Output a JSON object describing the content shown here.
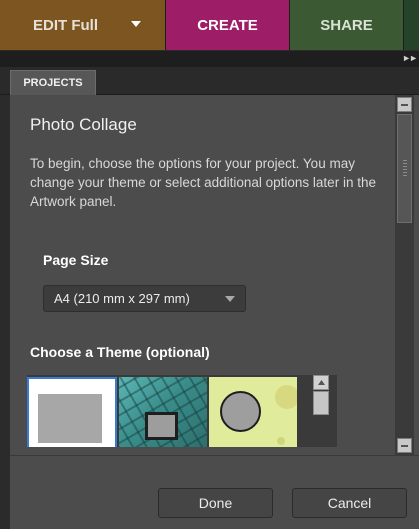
{
  "topbar": {
    "tabs": [
      {
        "label": "EDIT Full",
        "color": "#7d5520"
      },
      {
        "label": "CREATE",
        "color": "#9d1d66"
      },
      {
        "label": "SHARE",
        "color": "#3b5a33"
      }
    ],
    "extra_color": "#24432a"
  },
  "panel": {
    "tab_label": "PROJECTS",
    "title": "Photo Collage",
    "description": "To begin, choose the options for your project. You may change your theme or select additional options later in the Artwork panel.",
    "page_size_label": "Page Size",
    "page_size_value": "A4 (210 mm x 297 mm)",
    "theme_label": "Choose a Theme (optional)"
  },
  "buttons": {
    "done": "Done",
    "cancel": "Cancel"
  },
  "colors": {
    "accent_selection": "#3c7bd3",
    "panel_bg": "#4c4c4c",
    "theme_yellow": "#e1eb9c",
    "theme_teal": "#3a8d8b"
  },
  "icons": {
    "edit_dropdown": "triangle-down",
    "overflow": "fast-forward",
    "page_size_dropdown": "triangle-down"
  }
}
